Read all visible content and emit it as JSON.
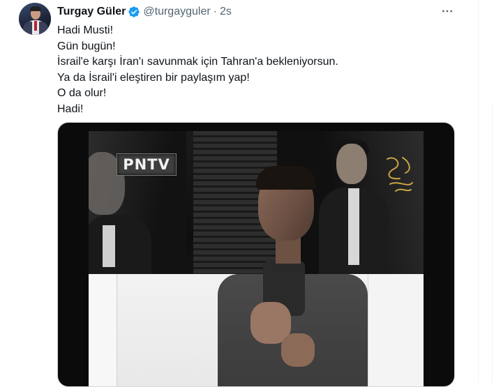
{
  "tweet": {
    "author": {
      "display_name": "Turgay Güler",
      "handle": "@turgayguler",
      "verified": true,
      "avatar_icon": "avatar-photo"
    },
    "separator": "·",
    "time": "2s",
    "more_icon": "more-horizontal-icon",
    "text_lines": [
      "Hadi Musti!",
      "Gün bugün!",
      "İsrail'e karşı İran'ı savunmak için Tahran'a bekleniyorsun.",
      "Ya da İsrail'i eleştiren bir paylaşım yap!",
      "O da olur!",
      "Hadi!"
    ],
    "media": {
      "type": "video",
      "channel_logo": "PNTV"
    }
  },
  "colors": {
    "text_primary": "#0f1419",
    "text_secondary": "#536471",
    "verified_blue": "#1d9bf0",
    "border": "#cfd9de"
  }
}
